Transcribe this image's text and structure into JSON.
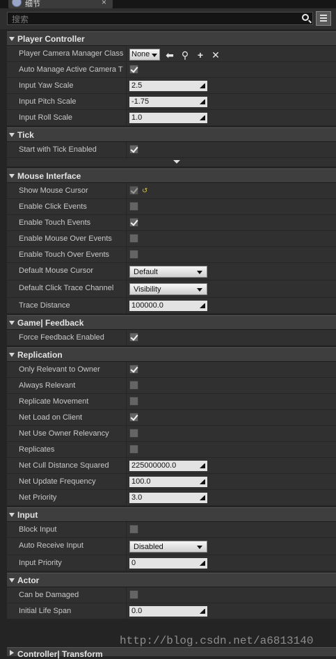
{
  "tab": {
    "label": "细节"
  },
  "search": {
    "placeholder": "搜索"
  },
  "sections": {
    "player_controller": {
      "title": "Player Controller",
      "camera_manager_label": "Player Camera Manager Class",
      "camera_manager_value": "None",
      "auto_manage_label": "Auto Manage Active Camera T",
      "yaw_label": "Input Yaw Scale",
      "yaw_value": "2.5",
      "pitch_label": "Input Pitch Scale",
      "pitch_value": "-1.75",
      "roll_label": "Input Roll Scale",
      "roll_value": "1.0"
    },
    "tick": {
      "title": "Tick",
      "start_label": "Start with Tick Enabled"
    },
    "mouse": {
      "title": "Mouse Interface",
      "show_cursor": "Show Mouse Cursor",
      "click_events": "Enable Click Events",
      "touch_events": "Enable Touch Events",
      "mouse_over": "Enable Mouse Over Events",
      "touch_over": "Enable Touch Over Events",
      "default_cursor_label": "Default Mouse Cursor",
      "default_cursor_value": "Default",
      "trace_channel_label": "Default Click Trace Channel",
      "trace_channel_value": "Visibility",
      "trace_distance_label": "Trace Distance",
      "trace_distance_value": "100000.0"
    },
    "feedback": {
      "title": "Game| Feedback",
      "force_label": "Force Feedback Enabled"
    },
    "replication": {
      "title": "Replication",
      "relevant_owner": "Only Relevant to Owner",
      "always_relevant": "Always Relevant",
      "replicate_movement": "Replicate Movement",
      "net_load": "Net Load on Client",
      "owner_relevancy": "Net Use Owner Relevancy",
      "replicates": "Replicates",
      "cull_label": "Net Cull Distance Squared",
      "cull_value": "225000000.0",
      "freq_label": "Net Update Frequency",
      "freq_value": "100.0",
      "priority_label": "Net Priority",
      "priority_value": "3.0"
    },
    "input": {
      "title": "Input",
      "block_label": "Block Input",
      "auto_receive_label": "Auto Receive Input",
      "auto_receive_value": "Disabled",
      "priority_label": "Input Priority",
      "priority_value": "0"
    },
    "actor": {
      "title": "Actor",
      "damaged_label": "Can be Damaged",
      "life_label": "Initial Life Span",
      "life_value": "0.0"
    },
    "controller_transform": {
      "title": "Controller| Transform"
    }
  },
  "watermark": "http://blog.csdn.net/a6813140",
  "icons": [
    "search-icon",
    "view-options-icon",
    "arrow-left-icon",
    "browse-icon",
    "plus-icon",
    "clear-icon",
    "reset-arrow-icon"
  ]
}
